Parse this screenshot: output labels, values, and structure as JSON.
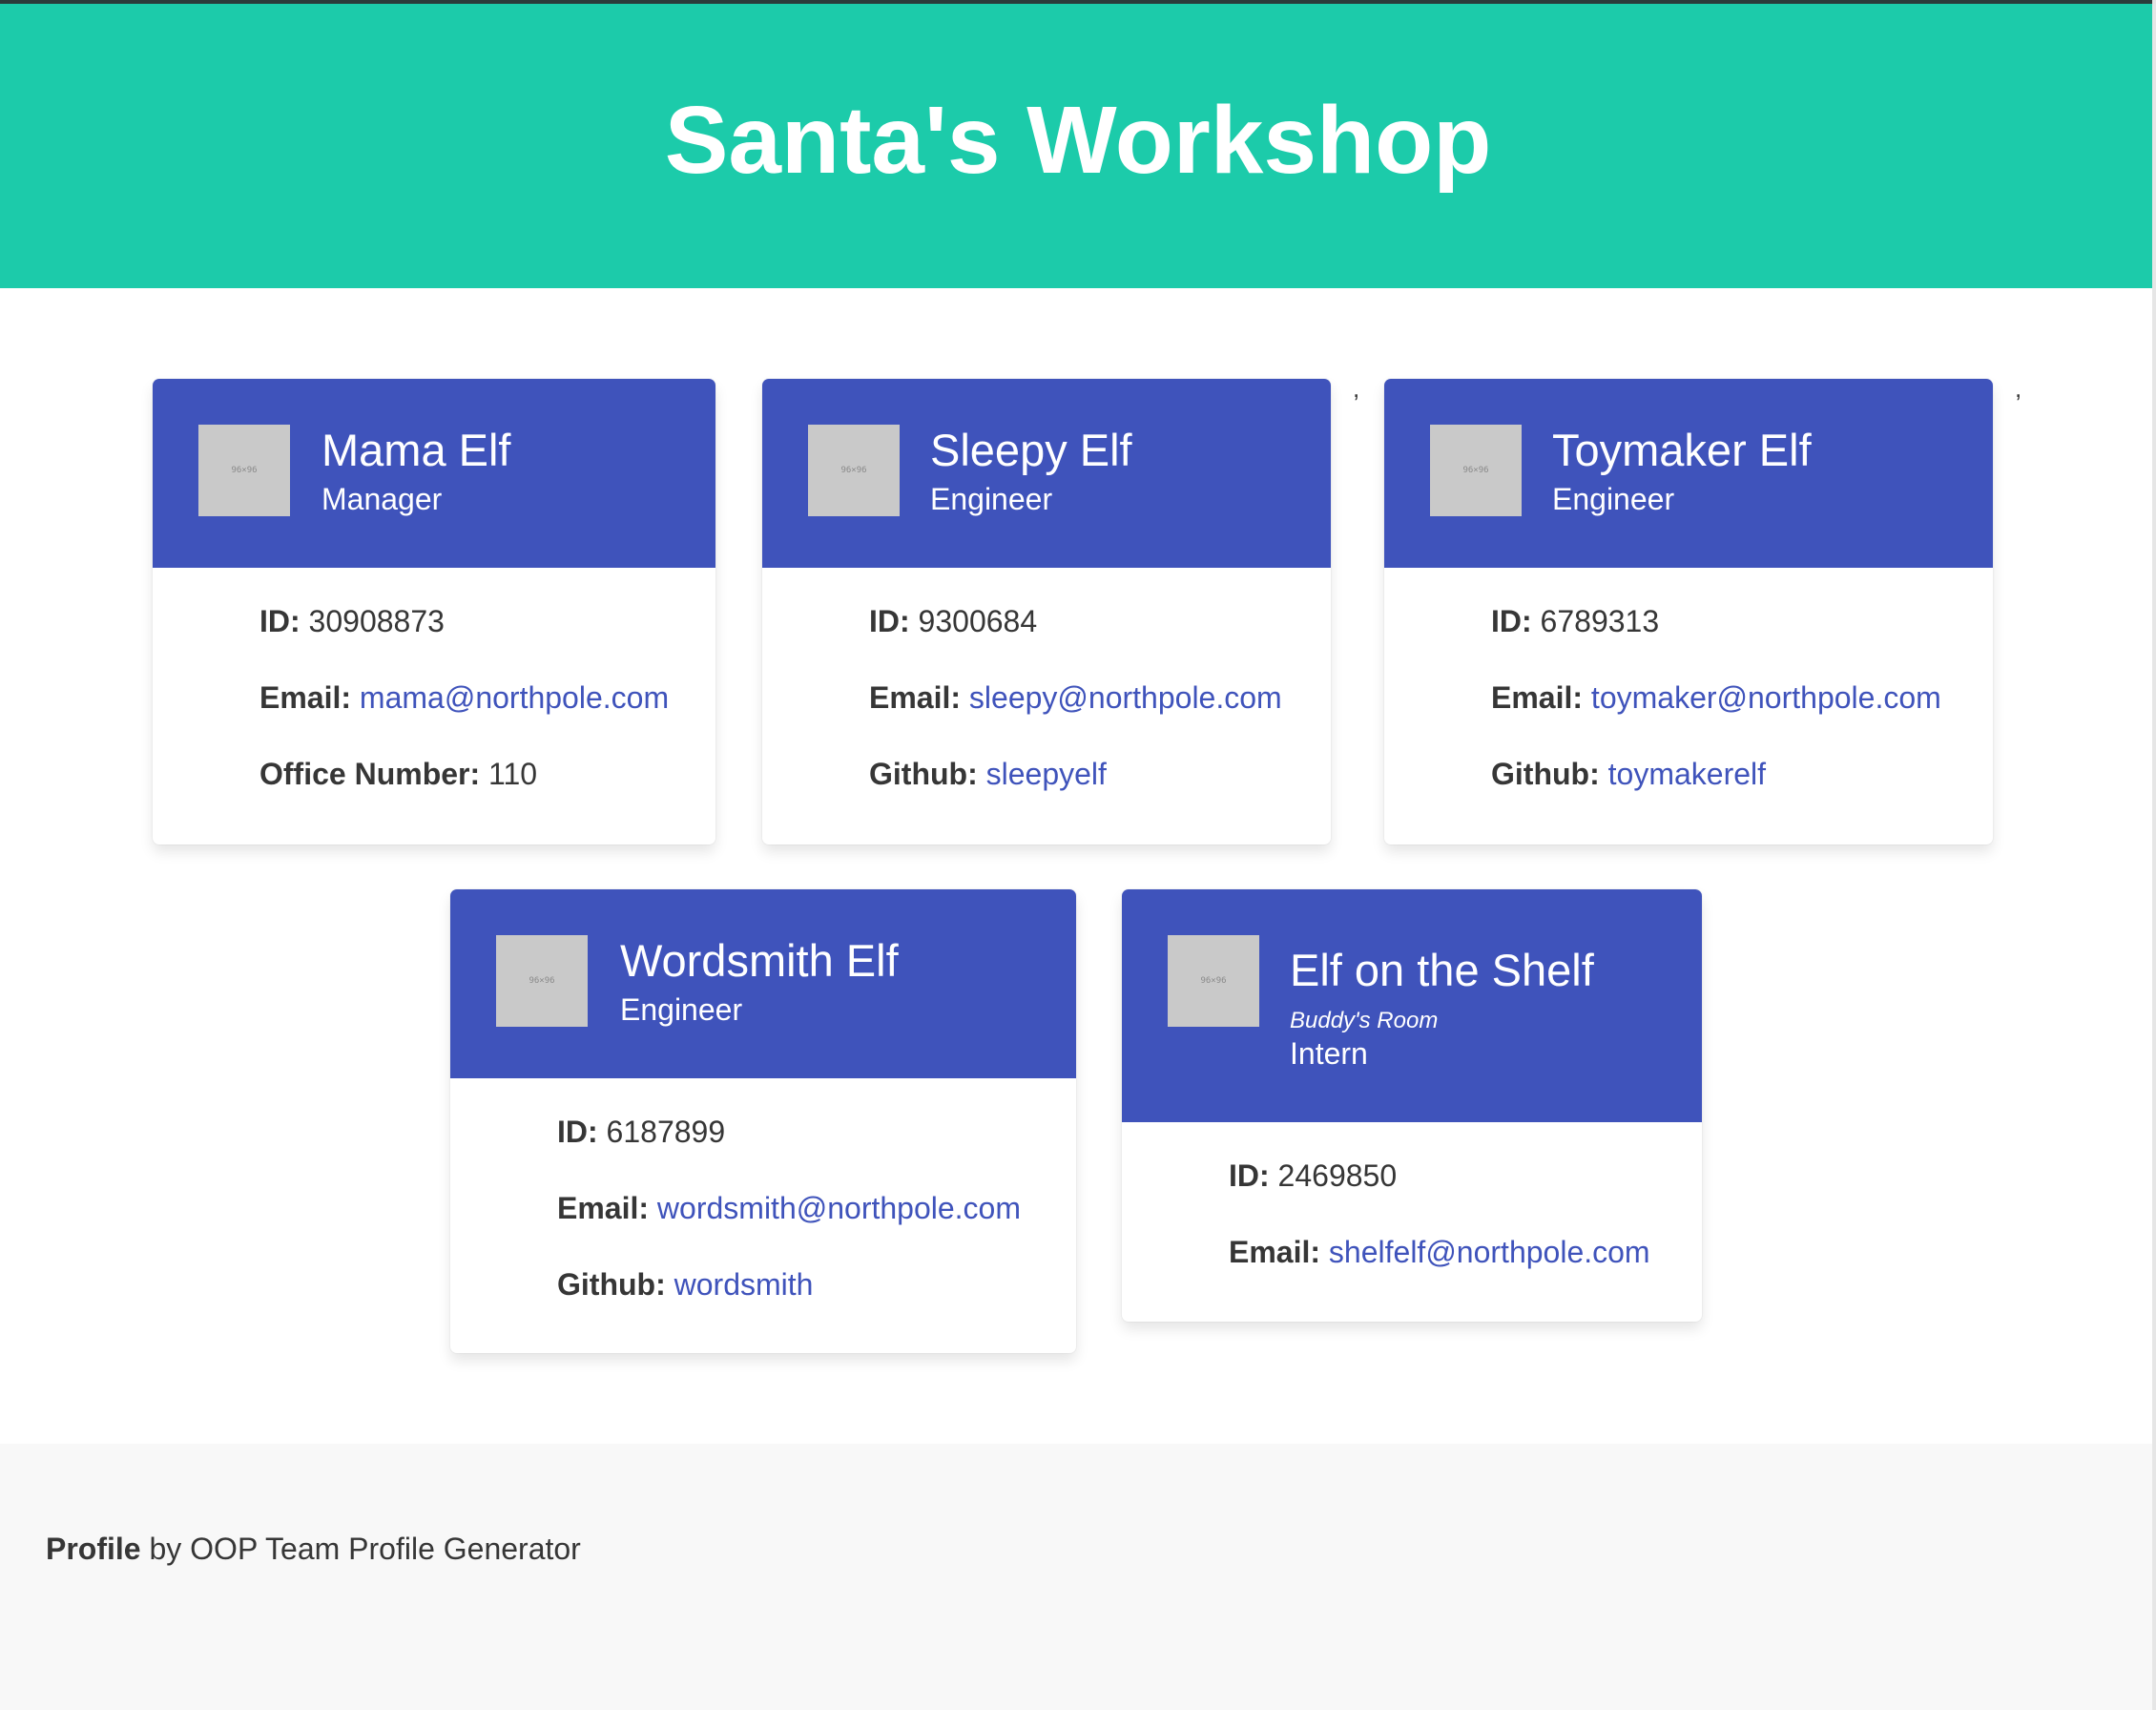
{
  "header": {
    "title": "Santa's Workshop"
  },
  "avatar_placeholder": "96×96",
  "cards": [
    {
      "name": "Mama Elf",
      "role": "Manager",
      "id_label": "ID:",
      "id": "30908873",
      "email_label": "Email:",
      "email": "mama@northpole.com",
      "extra_label": "Office Number:",
      "extra": "110"
    },
    {
      "name": "Sleepy Elf",
      "role": "Engineer",
      "id_label": "ID:",
      "id": "9300684",
      "email_label": "Email:",
      "email": "sleepy@northpole.com",
      "extra_label": "Github:",
      "extra": "sleepyelf"
    },
    {
      "name": "Toymaker Elf",
      "role": "Engineer",
      "id_label": "ID:",
      "id": "6789313",
      "email_label": "Email:",
      "email": "toymaker@northpole.com",
      "extra_label": "Github:",
      "extra": "toymakerelf"
    },
    {
      "name": "Wordsmith Elf",
      "role": "Engineer",
      "id_label": "ID:",
      "id": "6187899",
      "email_label": "Email:",
      "email": "wordsmith@northpole.com",
      "extra_label": "Github:",
      "extra": "wordsmith"
    },
    {
      "name": "Elf on the Shelf",
      "school": "Buddy's Room",
      "role": "Intern",
      "id_label": "ID:",
      "id": "2469850",
      "email_label": "Email:",
      "email": "shelfelf@northpole.com"
    }
  ],
  "stray_marks": [
    ",",
    ","
  ],
  "footer": {
    "brand": "Profile",
    "text": " by OOP Team Profile Generator"
  },
  "colors": {
    "hero": "#1ccbaa",
    "card_header": "#3f53bb",
    "link": "#3f53bb",
    "footer_bg": "#f8f8f8"
  }
}
